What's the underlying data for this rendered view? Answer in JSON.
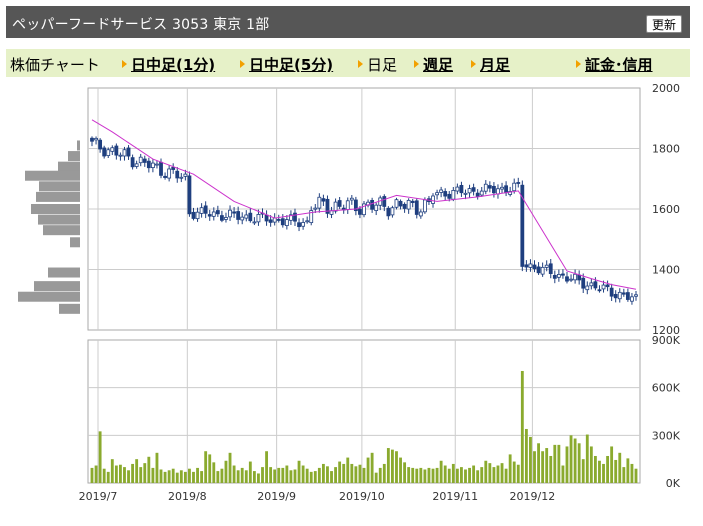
{
  "header": {
    "title": "ペッパーフードサービス 3053 東京 1部",
    "refresh_label": "更新"
  },
  "nav": {
    "label": "株価チャート",
    "items": [
      {
        "label": "日中足(1分)",
        "link": true
      },
      {
        "label": "日中足(5分)",
        "link": true
      },
      {
        "label": "日足",
        "link": false
      },
      {
        "label": "週足",
        "link": true
      },
      {
        "label": "月足",
        "link": true
      },
      {
        "label": "証金･信用",
        "link": true
      }
    ]
  },
  "colors": {
    "up": "#ffffff",
    "down": "#1f3f7f",
    "candle_outline": "#1f3f7f",
    "ma": "#cc33cc",
    "volume": "#8aaa2e",
    "grid": "#cccccc",
    "frame": "#aaaaaa",
    "profile": "#999999"
  },
  "chart_data": [
    {
      "type": "candlestick",
      "title": "",
      "x_tick_labels": [
        "2019/7",
        "2019/8",
        "2019/9",
        "2019/10",
        "2019/11",
        "2019/12"
      ],
      "y_tick_labels": [
        "2000",
        "1800",
        "1600",
        "1400",
        "1200"
      ],
      "ylim": [
        1200,
        2000
      ],
      "grid": true,
      "moving_average": {
        "x": [
          0,
          5,
          15,
          25,
          35,
          45,
          55,
          65,
          75,
          85,
          95,
          105,
          117,
          123,
          128,
          134
        ],
        "y": [
          1895,
          1855,
          1765,
          1715,
          1625,
          1570,
          1590,
          1600,
          1645,
          1625,
          1640,
          1660,
          1395,
          1370,
          1350,
          1335
        ]
      },
      "segments": [
        {
          "start": 0,
          "count": 24,
          "from": 1815,
          "to": 1700,
          "wiggle": 18,
          "trend": -5
        },
        {
          "start": 24,
          "count": 30,
          "from": 1590,
          "to": 1555,
          "wiggle": 14,
          "trend": 1
        },
        {
          "start": 54,
          "count": 30,
          "from": 1610,
          "to": 1610,
          "wiggle": 22,
          "trend": 2
        },
        {
          "start": 84,
          "count": 22,
          "from": 1650,
          "to": 1670,
          "wiggle": 14,
          "trend": 0
        },
        {
          "start": 106,
          "count": 29,
          "from": 1420,
          "to": 1300,
          "wiggle": 14,
          "trend": -1
        }
      ],
      "n_days": 135,
      "volume_profile": {
        "prices": [
          1810,
          1775,
          1740,
          1710,
          1675,
          1640,
          1600,
          1565,
          1530,
          1490,
          1390,
          1345,
          1310,
          1270
        ],
        "values": [
          3,
          12,
          22,
          55,
          41,
          44,
          49,
          42,
          37,
          10,
          32,
          46,
          62,
          21
        ]
      }
    },
    {
      "type": "bar",
      "title": "",
      "y_tick_labels": [
        "900K",
        "600K",
        "300K",
        "0K"
      ],
      "ylim": [
        0,
        900000
      ],
      "values": [
        95000,
        110000,
        325000,
        90000,
        70000,
        150000,
        110000,
        115000,
        100000,
        80000,
        120000,
        150000,
        100000,
        125000,
        165000,
        95000,
        190000,
        85000,
        70000,
        80000,
        90000,
        65000,
        80000,
        70000,
        90000,
        70000,
        95000,
        75000,
        200000,
        180000,
        130000,
        75000,
        90000,
        140000,
        190000,
        110000,
        80000,
        95000,
        80000,
        135000,
        75000,
        60000,
        100000,
        200000,
        100000,
        85000,
        95000,
        95000,
        110000,
        80000,
        85000,
        140000,
        110000,
        90000,
        70000,
        75000,
        95000,
        120000,
        105000,
        75000,
        100000,
        135000,
        120000,
        160000,
        120000,
        105000,
        115000,
        95000,
        160000,
        190000,
        65000,
        95000,
        120000,
        220000,
        210000,
        200000,
        160000,
        130000,
        100000,
        95000,
        90000,
        95000,
        85000,
        95000,
        90000,
        95000,
        140000,
        110000,
        90000,
        120000,
        90000,
        100000,
        85000,
        95000,
        110000,
        80000,
        100000,
        140000,
        125000,
        100000,
        110000,
        125000,
        90000,
        180000,
        135000,
        115000,
        705000,
        340000,
        290000,
        200000,
        250000,
        200000,
        220000,
        170000,
        240000,
        240000,
        110000,
        230000,
        300000,
        280000,
        250000,
        150000,
        305000,
        230000,
        170000,
        140000,
        120000,
        170000,
        230000,
        145000,
        190000,
        100000,
        155000,
        120000,
        90000
      ]
    }
  ]
}
